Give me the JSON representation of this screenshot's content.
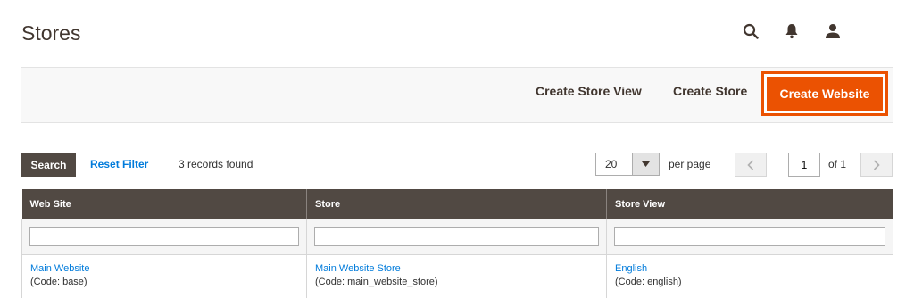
{
  "page": {
    "title": "Stores"
  },
  "header": {
    "icons": [
      "search-icon",
      "bell-icon",
      "user-icon"
    ]
  },
  "actions": {
    "create_store_view": "Create Store View",
    "create_store": "Create Store",
    "create_website": "Create Website",
    "highlight_color": "#eb5202"
  },
  "toolbar": {
    "search": "Search",
    "reset_filter": "Reset Filter",
    "records_found": "3 records found",
    "per_page_value": "20",
    "per_page_label": "per page",
    "current_page": "1",
    "of_pages": "of 1"
  },
  "grid": {
    "columns": [
      "Web Site",
      "Store",
      "Store View"
    ],
    "rows": [
      {
        "website": "Main Website",
        "website_code": "(Code: base)",
        "store": "Main Website Store",
        "store_code": "(Code: main_website_store)",
        "store_view": "English",
        "store_view_code": "(Code: english)"
      }
    ]
  },
  "colors": {
    "header_bg": "#514943",
    "link": "#007bdb",
    "accent": "#eb5202"
  }
}
